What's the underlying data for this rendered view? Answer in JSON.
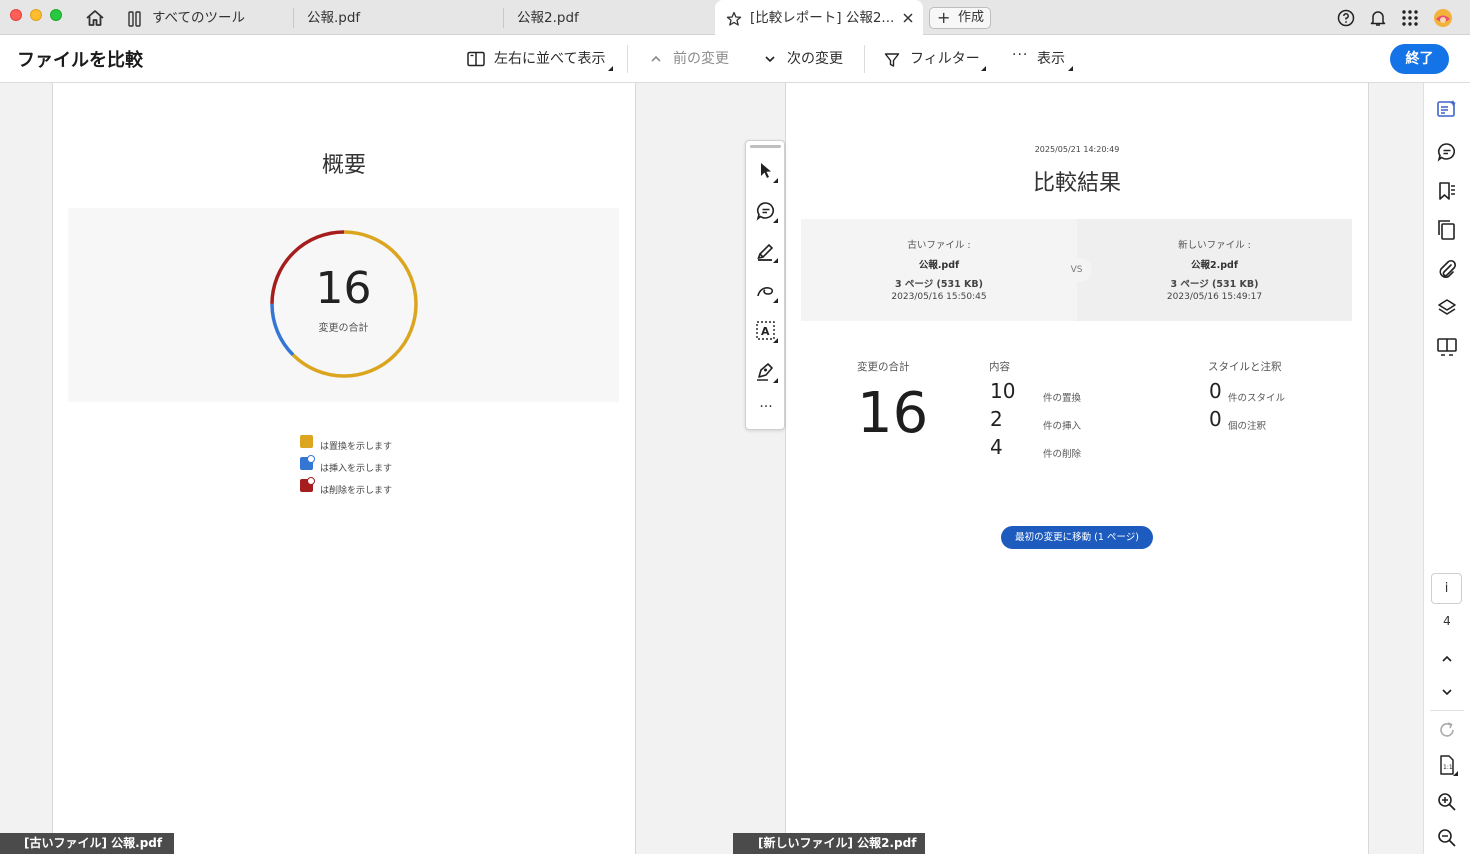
{
  "tabs": {
    "tools_label": "すべてのツール",
    "tab1": "公報.pdf",
    "tab2": "公報2.pdf",
    "tab3": "[比較レポート] 公報2...",
    "new_label": "作成"
  },
  "toolbar": {
    "title": "ファイルを比較",
    "side_by_side": "左右に並べて表示",
    "prev_change": "前の変更",
    "next_change": "次の変更",
    "filter": "フィルター",
    "view": "表示",
    "done": "終了"
  },
  "left_page": {
    "title": "概要",
    "total": "16",
    "total_label": "変更の合計",
    "legend": [
      {
        "label": "は置換を示します",
        "color": "#dba520"
      },
      {
        "label": "は挿入を示します",
        "color": "#3476d4"
      },
      {
        "label": "は削除を示します",
        "color": "#a51d1d"
      }
    ],
    "footer": "[古いファイル] 公報.pdf"
  },
  "donut": {
    "replace_color": "#dba520",
    "insert_color": "#3476d4",
    "delete_color": "#a51d1d",
    "replace": 10,
    "insert": 2,
    "delete": 4
  },
  "right_page": {
    "date": "2025/05/21 14:20:49",
    "title": "比較結果",
    "old": {
      "label": "古いファイル :",
      "name": "公報.pdf",
      "pages": "3 ページ (531 KB)",
      "time": "2023/05/16 15:50:45"
    },
    "vs": "VS",
    "new": {
      "label": "新しいファイル :",
      "name": "公報2.pdf",
      "pages": "3 ページ (531 KB)",
      "time": "2023/05/16 15:49:17"
    },
    "stats": {
      "total_header": "変更の合計",
      "total": "16",
      "content_header": "内容",
      "replace_n": "10",
      "replace_label": "件の置換",
      "insert_n": "2",
      "insert_label": "件の挿入",
      "delete_n": "4",
      "delete_label": "件の削除",
      "style_header": "スタイルと注釈",
      "style_n": "0",
      "style_label": "件のスタイル",
      "note_n": "0",
      "note_label": "個の注釈"
    },
    "goto_button": "最初の変更に移動 (1 ページ)",
    "footer": "[新しいファイル] 公報2.pdf"
  },
  "rail": {
    "info": "i",
    "page": "4"
  }
}
